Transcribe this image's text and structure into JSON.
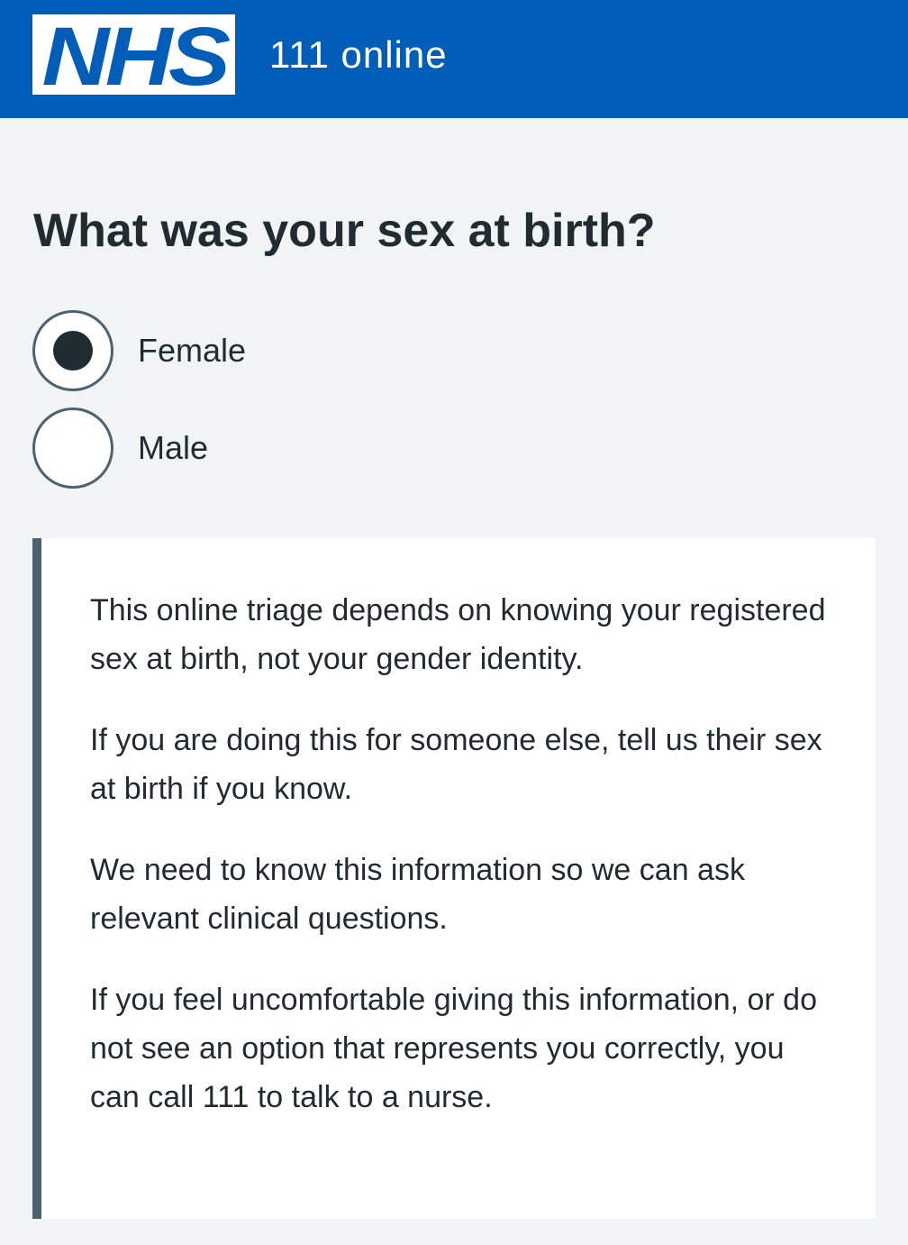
{
  "header": {
    "logo_text": "NHS",
    "service_name": "111 online",
    "brand_color": "#005eb8"
  },
  "question": {
    "title": "What was your sex at birth?"
  },
  "options": [
    {
      "label": "Female",
      "selected": true
    },
    {
      "label": "Male",
      "selected": false
    }
  ],
  "inset": {
    "paragraphs": [
      "This online triage depends on knowing your registered sex at birth, not your gender identity.",
      "If you are doing this for someone else, tell us their sex at birth if you know.",
      "We need to know this information so we can ask relevant clinical questions.",
      "If you feel uncomfortable giving this information, or do not see an option that represents you correctly, you can call 111 to talk to a nurse."
    ]
  },
  "colors": {
    "page_background": "#f0f4f5",
    "text": "#212b32",
    "border": "#4c6272"
  }
}
